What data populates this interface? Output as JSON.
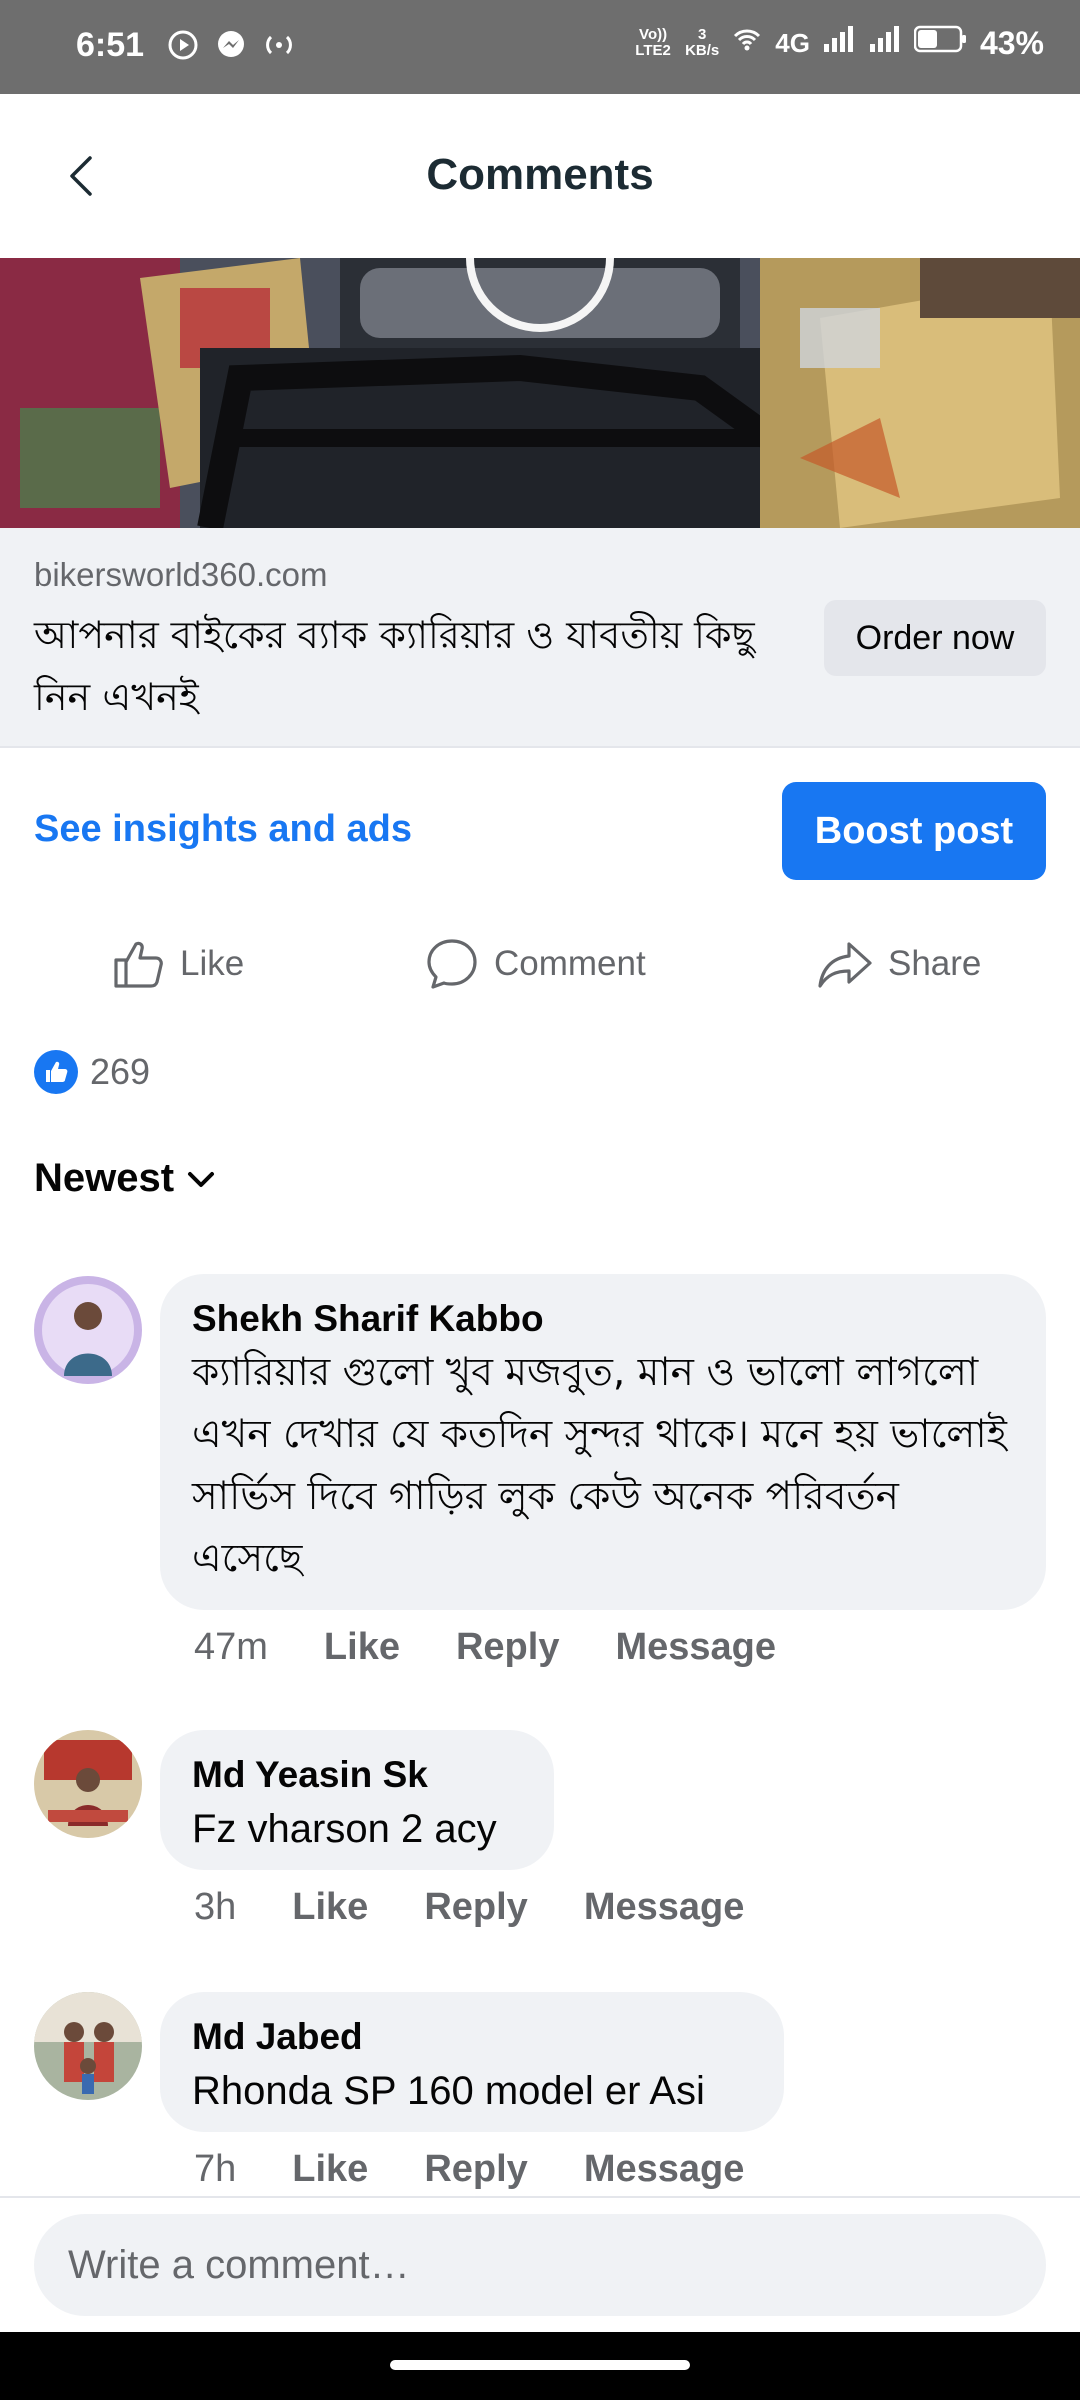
{
  "status_bar": {
    "time": "6:51",
    "network_label": "Vo)) LTE2",
    "data_rate_value": "3",
    "data_rate_unit": "KB/s",
    "network_type": "4G",
    "battery_percent": "43%"
  },
  "header": {
    "title": "Comments"
  },
  "link_preview": {
    "domain": "bikersworld360.com",
    "title": "আপনার বাইকের ব্যাক ক্যারিয়ার ও যাবতীয় কিছু নিন এখনই",
    "cta_label": "Order now"
  },
  "post_actions": {
    "insights_label": "See insights and ads",
    "boost_label": "Boost post",
    "like_label": "Like",
    "comment_label": "Comment",
    "share_label": "Share"
  },
  "reactions": {
    "count": "269"
  },
  "sort": {
    "label": "Newest"
  },
  "comments": [
    {
      "author": "Shekh Sharif Kabbo",
      "text": "ক্যারিয়ার গুলো খুব মজবুত, মান ও ভালো লাগলো এখন দেখার যে কতদিন সুন্দর থাকে। মনে হয় ভালোই সার্ভিস দিবে গাড়ির লুক কেউ অনেক পরিবর্তন এসেছে",
      "time": "47m",
      "like_label": "Like",
      "reply_label": "Reply",
      "message_label": "Message"
    },
    {
      "author": "Md Yeasin Sk",
      "text": "Fz vharson 2 acy",
      "time": "3h",
      "like_label": "Like",
      "reply_label": "Reply",
      "message_label": "Message"
    },
    {
      "author": "Md Jabed",
      "text": "Rhonda SP 160 model er Asi",
      "time": "7h",
      "like_label": "Like",
      "reply_label": "Reply",
      "message_label": "Message"
    }
  ],
  "composer": {
    "placeholder": "Write a comment…"
  },
  "colors": {
    "accent": "#1877f2",
    "bubble": "#f0f2f5",
    "secondary_text": "#65676b"
  }
}
